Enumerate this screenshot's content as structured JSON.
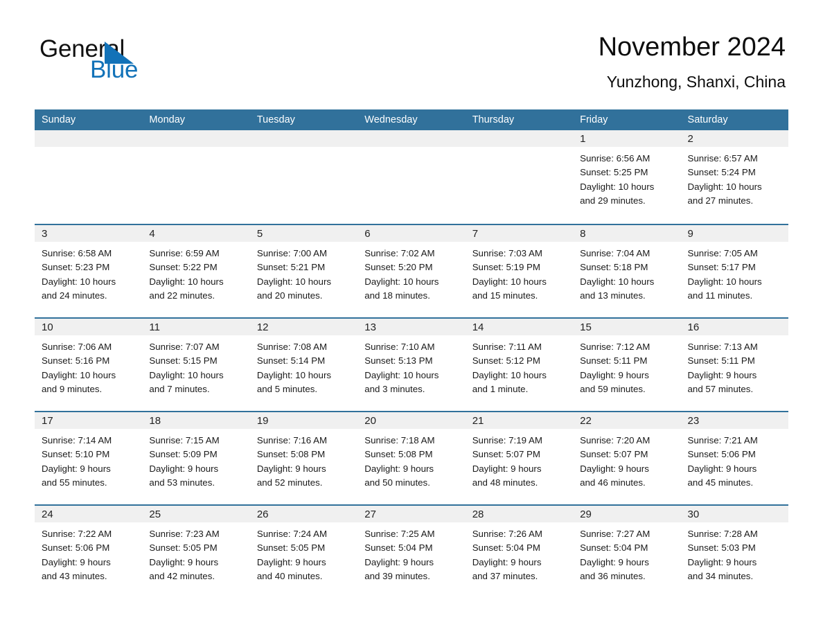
{
  "brand": {
    "name_part1": "General",
    "name_part2": "Blue",
    "accent_color": "#1272b8"
  },
  "header": {
    "title": "November 2024",
    "location": "Yunzhong, Shanxi, China"
  },
  "calendar": {
    "header_color": "#31719b",
    "daynum_band_color": "#f0f0f0",
    "day_names": [
      "Sunday",
      "Monday",
      "Tuesday",
      "Wednesday",
      "Thursday",
      "Friday",
      "Saturday"
    ],
    "weeks": [
      [
        {
          "empty": true
        },
        {
          "empty": true
        },
        {
          "empty": true
        },
        {
          "empty": true
        },
        {
          "empty": true
        },
        {
          "day": "1",
          "sunrise": "Sunrise: 6:56 AM",
          "sunset": "Sunset: 5:25 PM",
          "daylight_line1": "Daylight: 10 hours",
          "daylight_line2": "and 29 minutes."
        },
        {
          "day": "2",
          "sunrise": "Sunrise: 6:57 AM",
          "sunset": "Sunset: 5:24 PM",
          "daylight_line1": "Daylight: 10 hours",
          "daylight_line2": "and 27 minutes."
        }
      ],
      [
        {
          "day": "3",
          "sunrise": "Sunrise: 6:58 AM",
          "sunset": "Sunset: 5:23 PM",
          "daylight_line1": "Daylight: 10 hours",
          "daylight_line2": "and 24 minutes."
        },
        {
          "day": "4",
          "sunrise": "Sunrise: 6:59 AM",
          "sunset": "Sunset: 5:22 PM",
          "daylight_line1": "Daylight: 10 hours",
          "daylight_line2": "and 22 minutes."
        },
        {
          "day": "5",
          "sunrise": "Sunrise: 7:00 AM",
          "sunset": "Sunset: 5:21 PM",
          "daylight_line1": "Daylight: 10 hours",
          "daylight_line2": "and 20 minutes."
        },
        {
          "day": "6",
          "sunrise": "Sunrise: 7:02 AM",
          "sunset": "Sunset: 5:20 PM",
          "daylight_line1": "Daylight: 10 hours",
          "daylight_line2": "and 18 minutes."
        },
        {
          "day": "7",
          "sunrise": "Sunrise: 7:03 AM",
          "sunset": "Sunset: 5:19 PM",
          "daylight_line1": "Daylight: 10 hours",
          "daylight_line2": "and 15 minutes."
        },
        {
          "day": "8",
          "sunrise": "Sunrise: 7:04 AM",
          "sunset": "Sunset: 5:18 PM",
          "daylight_line1": "Daylight: 10 hours",
          "daylight_line2": "and 13 minutes."
        },
        {
          "day": "9",
          "sunrise": "Sunrise: 7:05 AM",
          "sunset": "Sunset: 5:17 PM",
          "daylight_line1": "Daylight: 10 hours",
          "daylight_line2": "and 11 minutes."
        }
      ],
      [
        {
          "day": "10",
          "sunrise": "Sunrise: 7:06 AM",
          "sunset": "Sunset: 5:16 PM",
          "daylight_line1": "Daylight: 10 hours",
          "daylight_line2": "and 9 minutes."
        },
        {
          "day": "11",
          "sunrise": "Sunrise: 7:07 AM",
          "sunset": "Sunset: 5:15 PM",
          "daylight_line1": "Daylight: 10 hours",
          "daylight_line2": "and 7 minutes."
        },
        {
          "day": "12",
          "sunrise": "Sunrise: 7:08 AM",
          "sunset": "Sunset: 5:14 PM",
          "daylight_line1": "Daylight: 10 hours",
          "daylight_line2": "and 5 minutes."
        },
        {
          "day": "13",
          "sunrise": "Sunrise: 7:10 AM",
          "sunset": "Sunset: 5:13 PM",
          "daylight_line1": "Daylight: 10 hours",
          "daylight_line2": "and 3 minutes."
        },
        {
          "day": "14",
          "sunrise": "Sunrise: 7:11 AM",
          "sunset": "Sunset: 5:12 PM",
          "daylight_line1": "Daylight: 10 hours",
          "daylight_line2": "and 1 minute."
        },
        {
          "day": "15",
          "sunrise": "Sunrise: 7:12 AM",
          "sunset": "Sunset: 5:11 PM",
          "daylight_line1": "Daylight: 9 hours",
          "daylight_line2": "and 59 minutes."
        },
        {
          "day": "16",
          "sunrise": "Sunrise: 7:13 AM",
          "sunset": "Sunset: 5:11 PM",
          "daylight_line1": "Daylight: 9 hours",
          "daylight_line2": "and 57 minutes."
        }
      ],
      [
        {
          "day": "17",
          "sunrise": "Sunrise: 7:14 AM",
          "sunset": "Sunset: 5:10 PM",
          "daylight_line1": "Daylight: 9 hours",
          "daylight_line2": "and 55 minutes."
        },
        {
          "day": "18",
          "sunrise": "Sunrise: 7:15 AM",
          "sunset": "Sunset: 5:09 PM",
          "daylight_line1": "Daylight: 9 hours",
          "daylight_line2": "and 53 minutes."
        },
        {
          "day": "19",
          "sunrise": "Sunrise: 7:16 AM",
          "sunset": "Sunset: 5:08 PM",
          "daylight_line1": "Daylight: 9 hours",
          "daylight_line2": "and 52 minutes."
        },
        {
          "day": "20",
          "sunrise": "Sunrise: 7:18 AM",
          "sunset": "Sunset: 5:08 PM",
          "daylight_line1": "Daylight: 9 hours",
          "daylight_line2": "and 50 minutes."
        },
        {
          "day": "21",
          "sunrise": "Sunrise: 7:19 AM",
          "sunset": "Sunset: 5:07 PM",
          "daylight_line1": "Daylight: 9 hours",
          "daylight_line2": "and 48 minutes."
        },
        {
          "day": "22",
          "sunrise": "Sunrise: 7:20 AM",
          "sunset": "Sunset: 5:07 PM",
          "daylight_line1": "Daylight: 9 hours",
          "daylight_line2": "and 46 minutes."
        },
        {
          "day": "23",
          "sunrise": "Sunrise: 7:21 AM",
          "sunset": "Sunset: 5:06 PM",
          "daylight_line1": "Daylight: 9 hours",
          "daylight_line2": "and 45 minutes."
        }
      ],
      [
        {
          "day": "24",
          "sunrise": "Sunrise: 7:22 AM",
          "sunset": "Sunset: 5:06 PM",
          "daylight_line1": "Daylight: 9 hours",
          "daylight_line2": "and 43 minutes."
        },
        {
          "day": "25",
          "sunrise": "Sunrise: 7:23 AM",
          "sunset": "Sunset: 5:05 PM",
          "daylight_line1": "Daylight: 9 hours",
          "daylight_line2": "and 42 minutes."
        },
        {
          "day": "26",
          "sunrise": "Sunrise: 7:24 AM",
          "sunset": "Sunset: 5:05 PM",
          "daylight_line1": "Daylight: 9 hours",
          "daylight_line2": "and 40 minutes."
        },
        {
          "day": "27",
          "sunrise": "Sunrise: 7:25 AM",
          "sunset": "Sunset: 5:04 PM",
          "daylight_line1": "Daylight: 9 hours",
          "daylight_line2": "and 39 minutes."
        },
        {
          "day": "28",
          "sunrise": "Sunrise: 7:26 AM",
          "sunset": "Sunset: 5:04 PM",
          "daylight_line1": "Daylight: 9 hours",
          "daylight_line2": "and 37 minutes."
        },
        {
          "day": "29",
          "sunrise": "Sunrise: 7:27 AM",
          "sunset": "Sunset: 5:04 PM",
          "daylight_line1": "Daylight: 9 hours",
          "daylight_line2": "and 36 minutes."
        },
        {
          "day": "30",
          "sunrise": "Sunrise: 7:28 AM",
          "sunset": "Sunset: 5:03 PM",
          "daylight_line1": "Daylight: 9 hours",
          "daylight_line2": "and 34 minutes."
        }
      ]
    ]
  }
}
